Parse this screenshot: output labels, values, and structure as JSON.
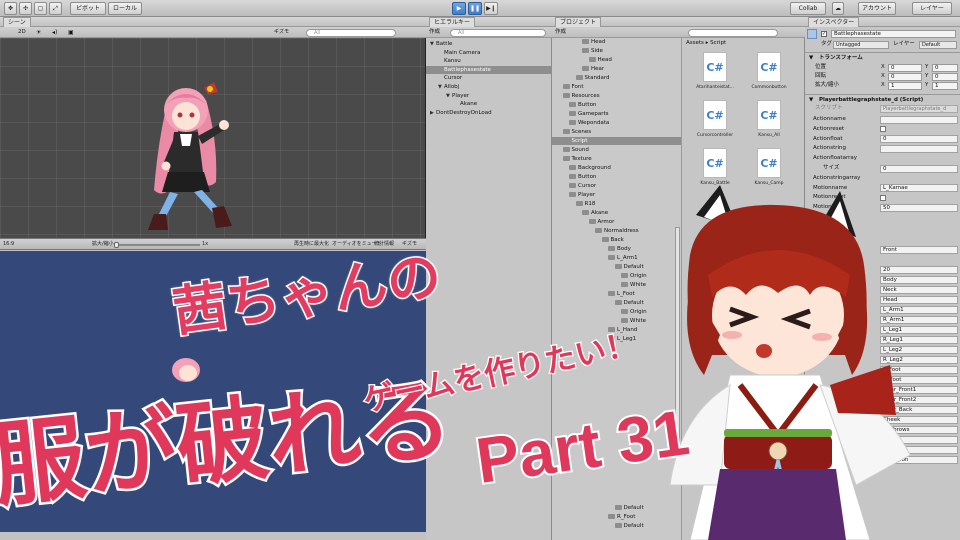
{
  "toolbar": {
    "pivot_label": "ピボット",
    "local_label": "ローカル",
    "collab_label": "Collab",
    "account_label": "アカウント",
    "layers_label": "レイヤー"
  },
  "scene": {
    "mode_label": "2D",
    "gizmos_label": "ギズモ",
    "search_placeholder": "All",
    "tab_label": "シーン"
  },
  "game": {
    "aspect_label": "16:9",
    "scale_label": "拡大/縮小",
    "scale_value": "1x",
    "maximize_label": "再生時に最大化",
    "mute_label": "オーディオをミュート",
    "stats_label": "統計情報",
    "gizmos_label": "ギズモ"
  },
  "hierarchy": {
    "title": "ヒエラルキー",
    "create_label": "作成",
    "search_placeholder": "All",
    "items": [
      {
        "label": "Battle",
        "depth": 0,
        "arrow": "▼",
        "selected": false
      },
      {
        "label": "Main Camera",
        "depth": 1,
        "arrow": "",
        "selected": false
      },
      {
        "label": "Kansu",
        "depth": 1,
        "arrow": "",
        "selected": false
      },
      {
        "label": "Battlephasestate",
        "depth": 1,
        "arrow": "",
        "selected": true
      },
      {
        "label": "Cursor",
        "depth": 1,
        "arrow": "",
        "selected": false
      },
      {
        "label": "Allobj",
        "depth": 1,
        "arrow": "▼",
        "selected": false
      },
      {
        "label": "Player",
        "depth": 2,
        "arrow": "▼",
        "selected": false
      },
      {
        "label": "Akane",
        "depth": 3,
        "arrow": "",
        "selected": false
      },
      {
        "label": "DontDestroyOnLoad",
        "depth": 0,
        "arrow": "▶",
        "selected": false
      }
    ]
  },
  "project": {
    "title": "プロジェクト",
    "create_label": "作成",
    "breadcrumb": [
      "Assets",
      "Script"
    ],
    "folders": [
      {
        "label": "Head",
        "depth": 4
      },
      {
        "label": "Side",
        "depth": 4
      },
      {
        "label": "Head",
        "depth": 5
      },
      {
        "label": "Hear",
        "depth": 4
      },
      {
        "label": "Standard",
        "depth": 3
      },
      {
        "label": "Font",
        "depth": 1
      },
      {
        "label": "Resources",
        "depth": 1
      },
      {
        "label": "Button",
        "depth": 2
      },
      {
        "label": "Gameparts",
        "depth": 2
      },
      {
        "label": "Wepondata",
        "depth": 2
      },
      {
        "label": "Scenes",
        "depth": 1
      },
      {
        "label": "Script",
        "depth": 1,
        "selected": true
      },
      {
        "label": "Sound",
        "depth": 1
      },
      {
        "label": "Texture",
        "depth": 1
      },
      {
        "label": "Background",
        "depth": 2
      },
      {
        "label": "Button",
        "depth": 2
      },
      {
        "label": "Cursor",
        "depth": 2
      },
      {
        "label": "Player",
        "depth": 2
      },
      {
        "label": "R18",
        "depth": 3
      },
      {
        "label": "Akane",
        "depth": 4
      },
      {
        "label": "Armor",
        "depth": 5
      },
      {
        "label": "Normaldress",
        "depth": 6
      },
      {
        "label": "Back",
        "depth": 7
      },
      {
        "label": "Body",
        "depth": 8
      },
      {
        "label": "L_Arm1",
        "depth": 8
      },
      {
        "label": "Default",
        "depth": 9
      },
      {
        "label": "Origin",
        "depth": 10
      },
      {
        "label": "White",
        "depth": 10
      },
      {
        "label": "L_Foot",
        "depth": 8
      },
      {
        "label": "Default",
        "depth": 9
      },
      {
        "label": "Origin",
        "depth": 10
      },
      {
        "label": "White",
        "depth": 10
      },
      {
        "label": "L_Hand",
        "depth": 8
      },
      {
        "label": "L_Leg1",
        "depth": 8
      }
    ],
    "lower_folders": [
      {
        "label": "Default",
        "depth": 9
      },
      {
        "label": "R_Foot",
        "depth": 8
      },
      {
        "label": "Default",
        "depth": 9
      }
    ],
    "scripts": [
      {
        "name": "Atarihanteistat..."
      },
      {
        "name": "Commonbutton"
      },
      {
        "name": "Cursorcontroller"
      },
      {
        "name": "Kansu_All"
      },
      {
        "name": "Kansu_Battle"
      },
      {
        "name": "Kansu_Camp"
      }
    ]
  },
  "inspector": {
    "title": "インスペクター",
    "object_name": "Battlephasestate",
    "tag_label": "タグ",
    "tag_value": "Untagged",
    "layer_label": "レイヤー",
    "layer_value": "Default",
    "transform_label": "トランスフォーム",
    "position_label": "位置",
    "rotation_label": "回転",
    "scale_label": "拡大/縮小",
    "x_label": "X",
    "y_label": "Y",
    "position": [
      "0",
      "0"
    ],
    "rotation": [
      "0",
      "0"
    ],
    "scale": [
      "1",
      "1"
    ],
    "component_label": "Playerbattlegraphstate_d (Script)",
    "script_label": "スクリプト",
    "script_value": "Playerbattlegraphstate_d",
    "fields": [
      {
        "label": "Actionname",
        "value": ""
      },
      {
        "label": "Actionreset",
        "value": ""
      },
      {
        "label": "Actionfloat",
        "value": "0"
      },
      {
        "label": "Actionstring",
        "value": ""
      },
      {
        "label": "Actionfloatarray",
        "value": ""
      },
      {
        "label": "サイズ",
        "value": "0"
      },
      {
        "label": "Actionstringarray",
        "value": ""
      },
      {
        "label": "Motionname",
        "value": "L_Kamae"
      },
      {
        "label": "Motionreset",
        "value": ""
      },
      {
        "label": "Motionfl",
        "value": "50"
      }
    ],
    "front_value": "Front",
    "array_size": "20",
    "parts": [
      "Body",
      "Neck",
      "Head",
      "L_Arm1",
      "R_Arm1",
      "L_Leg1",
      "R_Leg1",
      "L_Leg2",
      "R_Leg2",
      "L_Foot",
      "R_Foot",
      "Hear_Front1",
      "Hear_Front2",
      "Hear_Back",
      "Cheek",
      "Eyebrows",
      "Mouth",
      "L_Wepon",
      "R_Wepon"
    ],
    "part_index_labels": [
      "10",
      "11"
    ]
  },
  "overlay": {
    "line1": "茜ちゃんの",
    "line2": "服が破れる",
    "line3": "ゲームを作りたい！",
    "part": "Part 31"
  },
  "colors": {
    "title_pink": "#e0385b",
    "selection": "#3f7fcc",
    "game_bg": "#34497a",
    "scene_bg": "#4a4a4a"
  }
}
